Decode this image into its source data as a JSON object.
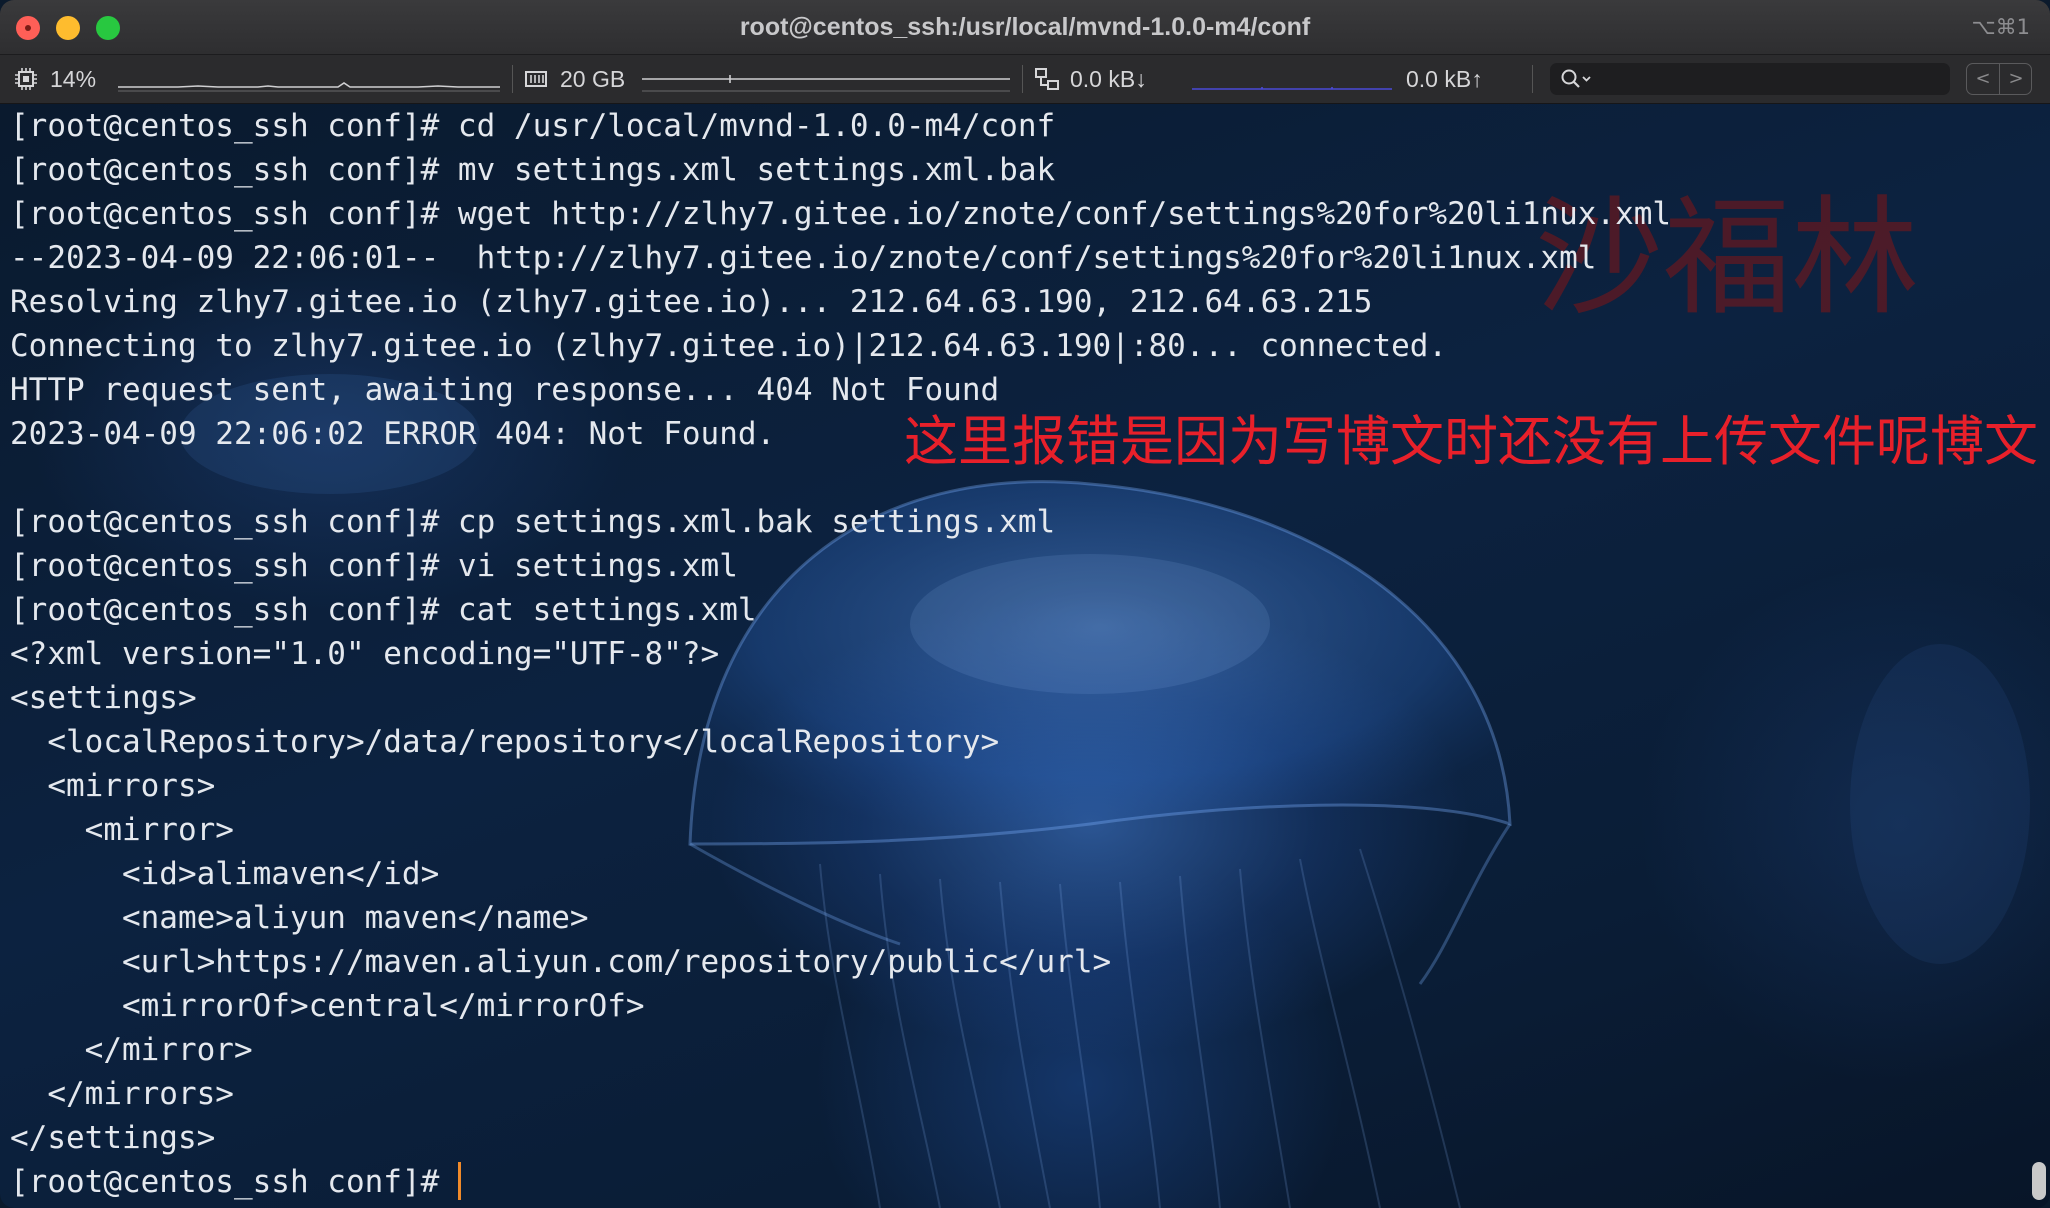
{
  "window": {
    "title": "root@centos_ssh:/usr/local/mvnd-1.0.0-m4/conf",
    "shortcut": "⌥⌘1"
  },
  "statusbar": {
    "cpu": "14%",
    "memory": "20 GB",
    "net_down": "0.0 kB↓",
    "net_up": "0.0 kB↑",
    "search_value": ""
  },
  "terminal": {
    "lines": [
      "[root@centos_ssh conf]# cd /usr/local/mvnd-1.0.0-m4/conf",
      "[root@centos_ssh conf]# mv settings.xml settings.xml.bak",
      "[root@centos_ssh conf]# wget http://zlhy7.gitee.io/znote/conf/settings%20for%20li1nux.xml",
      "--2023-04-09 22:06:01--  http://zlhy7.gitee.io/znote/conf/settings%20for%20li1nux.xml",
      "Resolving zlhy7.gitee.io (zlhy7.gitee.io)... 212.64.63.190, 212.64.63.215",
      "Connecting to zlhy7.gitee.io (zlhy7.gitee.io)|212.64.63.190|:80... connected.",
      "HTTP request sent, awaiting response... 404 Not Found",
      "2023-04-09 22:06:02 ERROR 404: Not Found.",
      "",
      "[root@centos_ssh conf]# cp settings.xml.bak settings.xml",
      "[root@centos_ssh conf]# vi settings.xml",
      "[root@centos_ssh conf]# cat settings.xml",
      "<?xml version=\"1.0\" encoding=\"UTF-8\"?>",
      "<settings>",
      "  <localRepository>/data/repository</localRepository>",
      "  <mirrors>",
      "    <mirror>",
      "      <id>alimaven</id>",
      "      <name>aliyun maven</name>",
      "      <url>https://maven.aliyun.com/repository/public</url>",
      "      <mirrorOf>central</mirrorOf>",
      "    </mirror>",
      "  </mirrors>",
      "</settings>"
    ],
    "prompt": "[root@centos_ssh conf]# "
  },
  "overlay": {
    "watermark": "沙福林",
    "annotation": "这里报错是因为写博文时还没有上传文件呢博文"
  },
  "colors": {
    "close": "#ff5f57",
    "minimize": "#febc2e",
    "maximize": "#28c840",
    "annotation": "#e8202a",
    "cursor": "#f08a2a"
  }
}
